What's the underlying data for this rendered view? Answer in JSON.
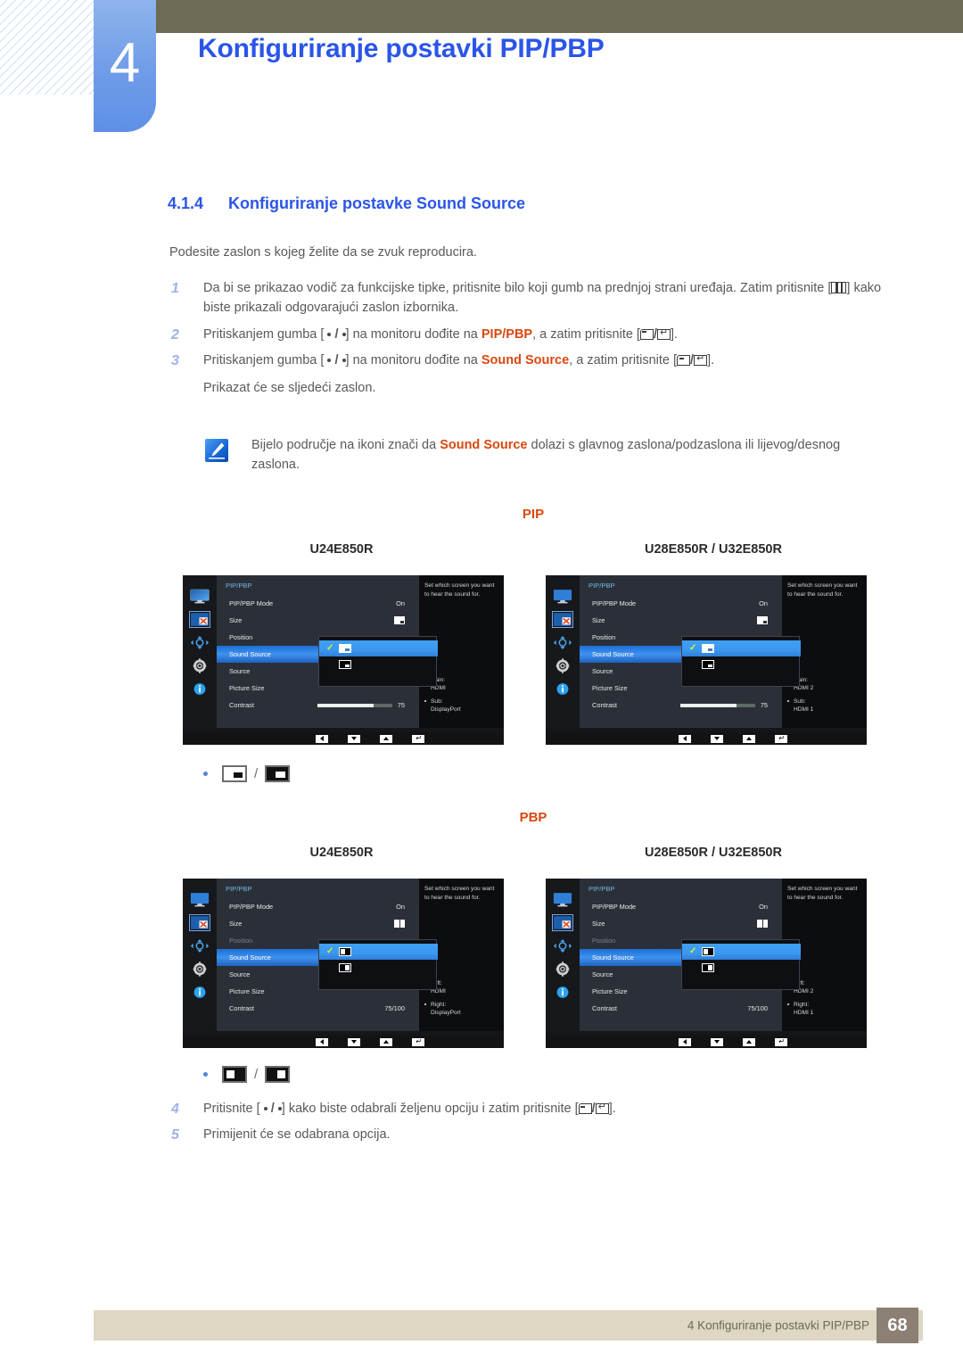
{
  "header": {
    "chapter_number": "4",
    "chapter_title": "Konfiguriranje postavki PIP/PBP"
  },
  "section": {
    "number": "4.1.4",
    "title": "Konfiguriranje postavke Sound Source",
    "intro": "Podesite zaslon s kojeg želite da se zvuk reproducira."
  },
  "steps": [
    {
      "num": "1",
      "text_a": "Da bi se prikazao vodič za funkcijske tipke, pritisnite bilo koji gumb na prednjoj strani uređaja. Zatim pritisnite [",
      "text_b": "] kako biste prikazali odgovarajući zaslon izbornika."
    },
    {
      "num": "2",
      "text_a": "Pritiskanjem gumba [",
      "sep": " / ",
      "text_b": "] na monitoru dođite na ",
      "keyword": "PIP/PBP",
      "text_c": ", a zatim pritisnite [",
      "text_d": "]."
    },
    {
      "num": "3",
      "text_a": "Pritiskanjem gumba [",
      "text_b": "] na monitoru dođite na ",
      "keyword": "Sound Source",
      "text_c": ", a zatim pritisnite [",
      "text_d": "].",
      "text_e": "Prikazat će se sljedeći zaslon."
    },
    {
      "num": "4",
      "text_a": "Pritisnite [",
      "text_b": "] kako biste odabrali željenu opciju i zatim pritisnite [",
      "text_c": "]."
    },
    {
      "num": "5",
      "text_a": "Primijenit će se odabrana opcija."
    }
  ],
  "note": {
    "text_a": "Bijelo područje na ikoni znači da ",
    "keyword": "Sound Source",
    "text_b": " dolazi s glavnog zaslona/podzaslona ili lijevog/desnog zaslona."
  },
  "groups": {
    "pip_label": "PIP",
    "pbp_label": "PBP",
    "model_left": "U24E850R",
    "model_right": "U28E850R / U32E850R"
  },
  "osd": {
    "title": "PIP/PBP",
    "rows": {
      "mode": "PIP/PBP Mode",
      "mode_value": "On",
      "size": "Size",
      "position": "Position",
      "sound_source": "Sound Source",
      "source": "Source",
      "picture_size": "Picture Size",
      "contrast": "Contrast"
    },
    "help_text": "Set which screen you want to hear the sound for.",
    "contrast_value_pip": "75",
    "contrast_value_pbp": "75/100",
    "contrast_percent": 75,
    "sources": {
      "pip_u24": [
        {
          "label": "Main:",
          "value": "HDMI"
        },
        {
          "label": "Sub:",
          "value": "DisplayPort"
        }
      ],
      "pip_u28": [
        {
          "label": "Main:",
          "value": "HDMI 2"
        },
        {
          "label": "Sub:",
          "value": "HDMI 1"
        }
      ],
      "pbp_u24": [
        {
          "label": "Left:",
          "value": "HDMI"
        },
        {
          "label": "Right:",
          "value": "DisplayPort"
        }
      ],
      "pbp_u28": [
        {
          "label": "Left:",
          "value": "HDMI 2"
        },
        {
          "label": "Right:",
          "value": "HDMI 1"
        }
      ]
    },
    "rail_icons": [
      "monitor-icon",
      "pip-pbp-icon",
      "position-arrows-icon",
      "gear-icon",
      "info-icon"
    ],
    "buttons": [
      "back-button",
      "down-button",
      "up-button",
      "enter-button"
    ],
    "checkmark": "✓"
  },
  "footer": {
    "text": "4 Konfiguriranje postavki PIP/PBP",
    "page": "68"
  },
  "colors": {
    "accent_blue": "#2B55E8",
    "keyword_orange": "#D9480F",
    "olive": "#6d6a55",
    "footer_bg": "#ddd7c4",
    "page_box": "#8c7f73"
  }
}
